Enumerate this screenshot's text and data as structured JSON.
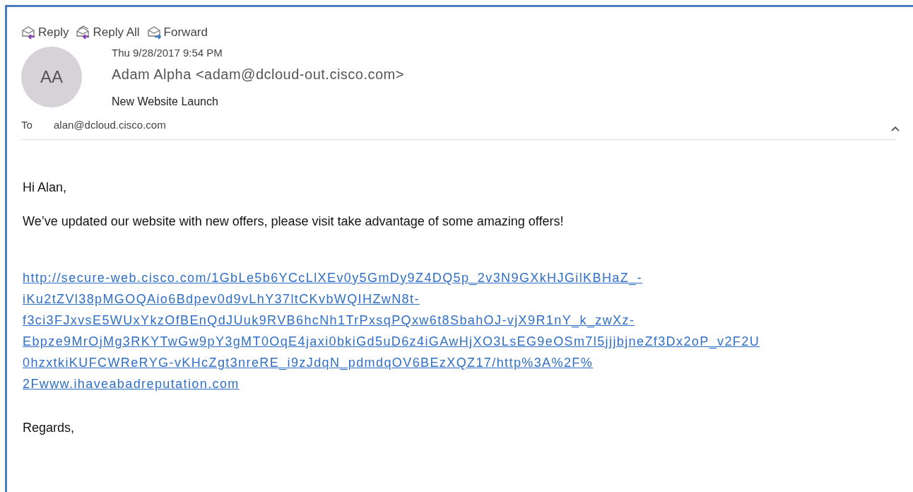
{
  "actions": [
    {
      "kind": "reply",
      "label": "Reply"
    },
    {
      "kind": "reply_all",
      "label": "Reply All"
    },
    {
      "kind": "forward",
      "label": "Forward"
    }
  ],
  "message": {
    "avatar": "AA",
    "date": "Thu 9/28/2017 9:54 PM",
    "sender": "Adam Alpha <adam@dcloud-out.cisco.com>",
    "subject": "New Website Launch",
    "to_label": "To",
    "to": "alan@dcloud.cisco.com",
    "expanded": true
  },
  "body": {
    "greeting": "Hi Alan,",
    "paragraph": "We’ve updated our website with new offers, please visit take advantage of some amazing offers!",
    "link_lines": [
      "http://secure-web.cisco.com/1GbLe5b6YCcLlXEv0y5GmDy9Z4DQ5p_2v3N9GXkHJGilKBHaZ_-",
      "iKu2tZVl38pMGOQAio6Bdpev0d9vLhY37ltCKvbWQIHZwN8t-",
      "f3ci3FJxvsE5WUxYkzOfBEnQdJUuk9RVB6hcNh1TrPxsqPQxw6t8SbahOJ-vjX9R1nY_k_zwXz-",
      "Ebpze9MrOjMg3RKYTwGw9pY3gMT0OqE4jaxi0bkiGd5uD6z4iGAwHjXO3LsEG9eOSm7l5jjjbjneZf3Dx2oP_v2F2U",
      "0hzxtkiKUFCWReRYG-vKHcZgt3nreRE_i9zJdqN_pdmdqOV6BEzXQZ17/http%3A%2F%",
      "2Fwww.ihaveabadreputation.com"
    ],
    "closing": "Regards,"
  }
}
